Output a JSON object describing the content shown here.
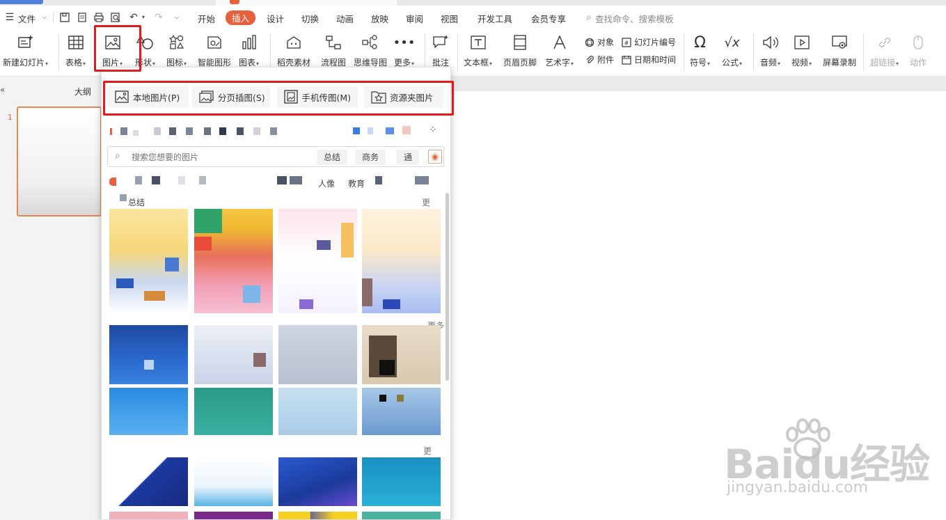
{
  "menu": {
    "file": "文件",
    "tabs": [
      "开始",
      "插入",
      "设计",
      "切换",
      "动画",
      "放映",
      "审阅",
      "视图",
      "开发工具",
      "会员专享"
    ],
    "active_tab": "插入",
    "search_placeholder": "查找命令、搜索模板"
  },
  "ribbon": {
    "new_slide": "新建幻灯片",
    "table": "表格",
    "picture": "图片",
    "shape": "形状",
    "icon": "图标",
    "smartart": "智能图形",
    "chart": "图表",
    "docer": "稻壳素材",
    "flowchart": "流程图",
    "mindmap": "思维导图",
    "more": "更多",
    "comment": "批注",
    "textbox": "文本框",
    "header_footer": "页眉页脚",
    "wordart": "艺术字",
    "object": "对象",
    "attachment": "附件",
    "slide_number": "幻灯片编号",
    "datetime": "日期和时间",
    "symbol": "符号",
    "formula": "公式",
    "audio": "音频",
    "video": "视频",
    "screen_record": "屏幕录制",
    "hyperlink": "超链接",
    "action": "动作"
  },
  "leftpane": {
    "outline": "大纲",
    "slide_number": "1",
    "collapse": "«"
  },
  "dropdown": {
    "options": [
      {
        "label": "本地图片(P)"
      },
      {
        "label": "分页插图(S)"
      },
      {
        "label": "手机传图(M)"
      },
      {
        "label": "资源夹图片"
      }
    ],
    "search_placeholder": "搜索您想要的图片",
    "chips": [
      "总结",
      "商务",
      "通"
    ],
    "tags_visible": [
      "人像",
      "教育"
    ],
    "section1": "总结",
    "more1": "更",
    "more2": "更多",
    "more3": "更"
  },
  "watermark": {
    "logo": "Baidu经验",
    "url": "jingyan.baidu.com"
  },
  "colors": {
    "accent": "#e8613f",
    "highlight": "#e31b1b"
  }
}
